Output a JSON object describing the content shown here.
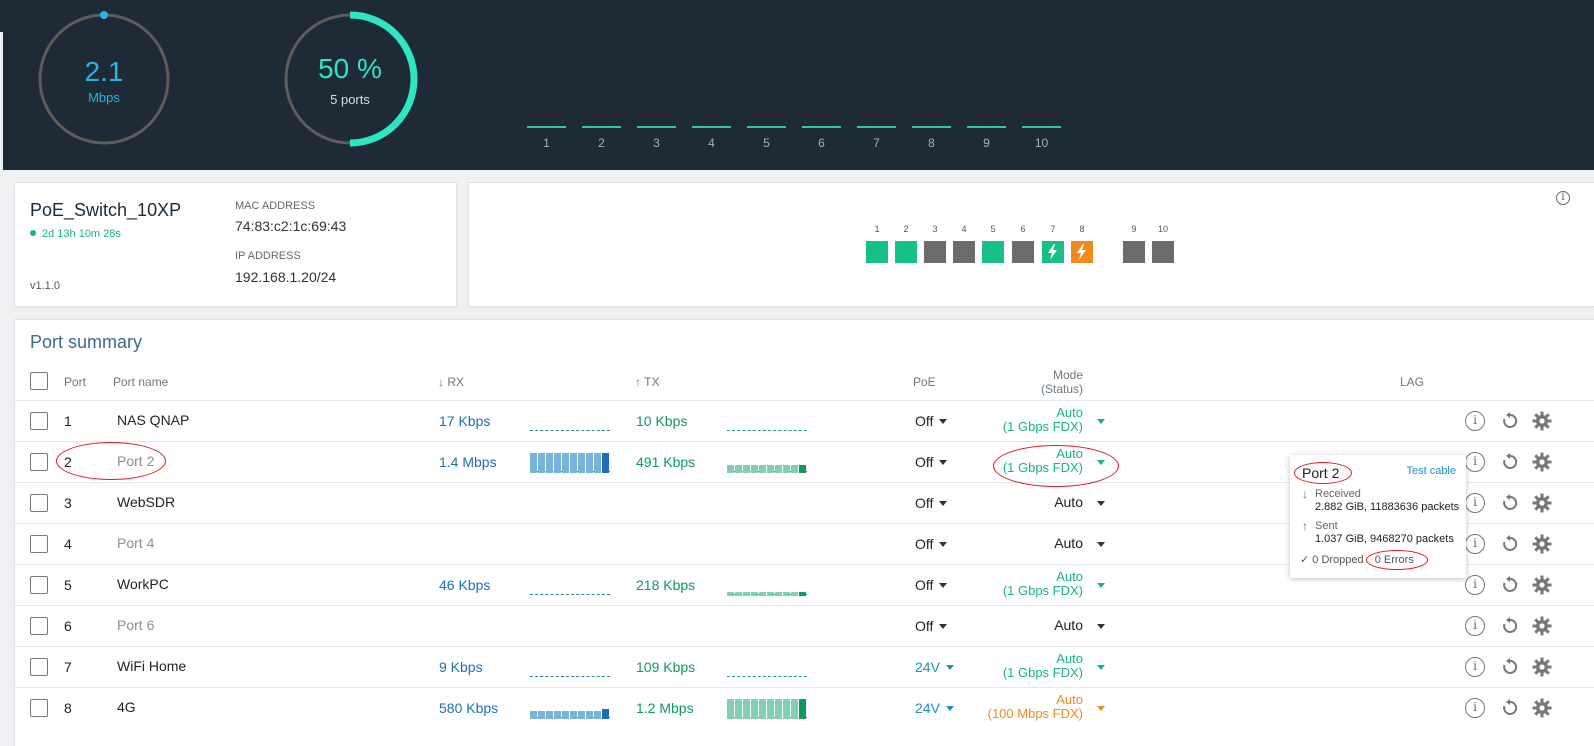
{
  "stats": {
    "throughput": {
      "value": "2.1",
      "unit": "Mbps"
    },
    "ports_utilization": {
      "value": "50 %",
      "label": "5 ports",
      "fraction": 0.5
    }
  },
  "throughput_bars": [
    "1",
    "2",
    "3",
    "4",
    "5",
    "6",
    "7",
    "8",
    "9",
    "10"
  ],
  "device": {
    "name": "PoE_Switch_10XP",
    "uptime": "2d 13h 10m 28s",
    "version": "v1.1.0",
    "mac_label": "MAC ADDRESS",
    "mac": "74:83:c2:1c:69:43",
    "ip_label": "IP ADDRESS",
    "ip": "192.168.1.20/24"
  },
  "port_panel": {
    "ports": [
      {
        "num": "1",
        "state": "up"
      },
      {
        "num": "2",
        "state": "up"
      },
      {
        "num": "3",
        "state": "down"
      },
      {
        "num": "4",
        "state": "down"
      },
      {
        "num": "5",
        "state": "up"
      },
      {
        "num": "6",
        "state": "down"
      },
      {
        "num": "7",
        "state": "poe"
      },
      {
        "num": "8",
        "state": "poe-warn"
      },
      {
        "num": "9",
        "state": "down"
      },
      {
        "num": "10",
        "state": "down"
      }
    ],
    "colors": {
      "up": "#16c088",
      "down": "#6b6b6b",
      "warn": "#f08a1c"
    }
  },
  "summary": {
    "title": "Port summary",
    "columns": {
      "port": "Port",
      "name": "Port name",
      "rx": "↓ RX",
      "tx": "↑ TX",
      "poe": "PoE",
      "mode": "Mode",
      "status": "(Status)",
      "lag": "LAG"
    },
    "rows": [
      {
        "port": "1",
        "name": "NAS QNAP",
        "rx": "17 Kbps",
        "tx": "10 Kbps",
        "poe": "Off",
        "mode": "Auto",
        "status": "(1 Gbps FDX)"
      },
      {
        "port": "2",
        "name": "Port 2",
        "rx": "1.4 Mbps",
        "tx": "491 Kbps",
        "poe": "Off",
        "mode": "Auto",
        "status": "(1 Gbps FDX)"
      },
      {
        "port": "3",
        "name": "WebSDR",
        "rx": "",
        "tx": "",
        "poe": "Off",
        "mode": "Auto",
        "status": ""
      },
      {
        "port": "4",
        "name": "Port 4",
        "rx": "",
        "tx": "",
        "poe": "Off",
        "mode": "Auto",
        "status": ""
      },
      {
        "port": "5",
        "name": "WorkPC",
        "rx": "46 Kbps",
        "tx": "218 Kbps",
        "poe": "Off",
        "mode": "Auto",
        "status": "(1 Gbps FDX)"
      },
      {
        "port": "6",
        "name": "Port 6",
        "rx": "",
        "tx": "",
        "poe": "Off",
        "mode": "Auto",
        "status": ""
      },
      {
        "port": "7",
        "name": "WiFi Home",
        "rx": "9 Kbps",
        "tx": "109 Kbps",
        "poe": "24V",
        "mode": "Auto",
        "status": "(1 Gbps FDX)"
      },
      {
        "port": "8",
        "name": "4G",
        "rx": "580 Kbps",
        "tx": "1.2 Mbps",
        "poe": "24V",
        "mode": "Auto",
        "status": "(100 Mbps FDX)"
      }
    ]
  },
  "popup": {
    "title": "Port 2",
    "test_cable": "Test cable",
    "received_label": "Received",
    "received_value": "2.882 GiB, 11883636 packets",
    "sent_label": "Sent",
    "sent_value": "1.037 GiB, 9468270 packets",
    "dropped": "0 Dropped",
    "errors": "0 Errors"
  },
  "icons": {
    "info": "info-icon",
    "reset": "restart-icon",
    "settings": "gear-icon",
    "poe": "lightning-icon"
  }
}
